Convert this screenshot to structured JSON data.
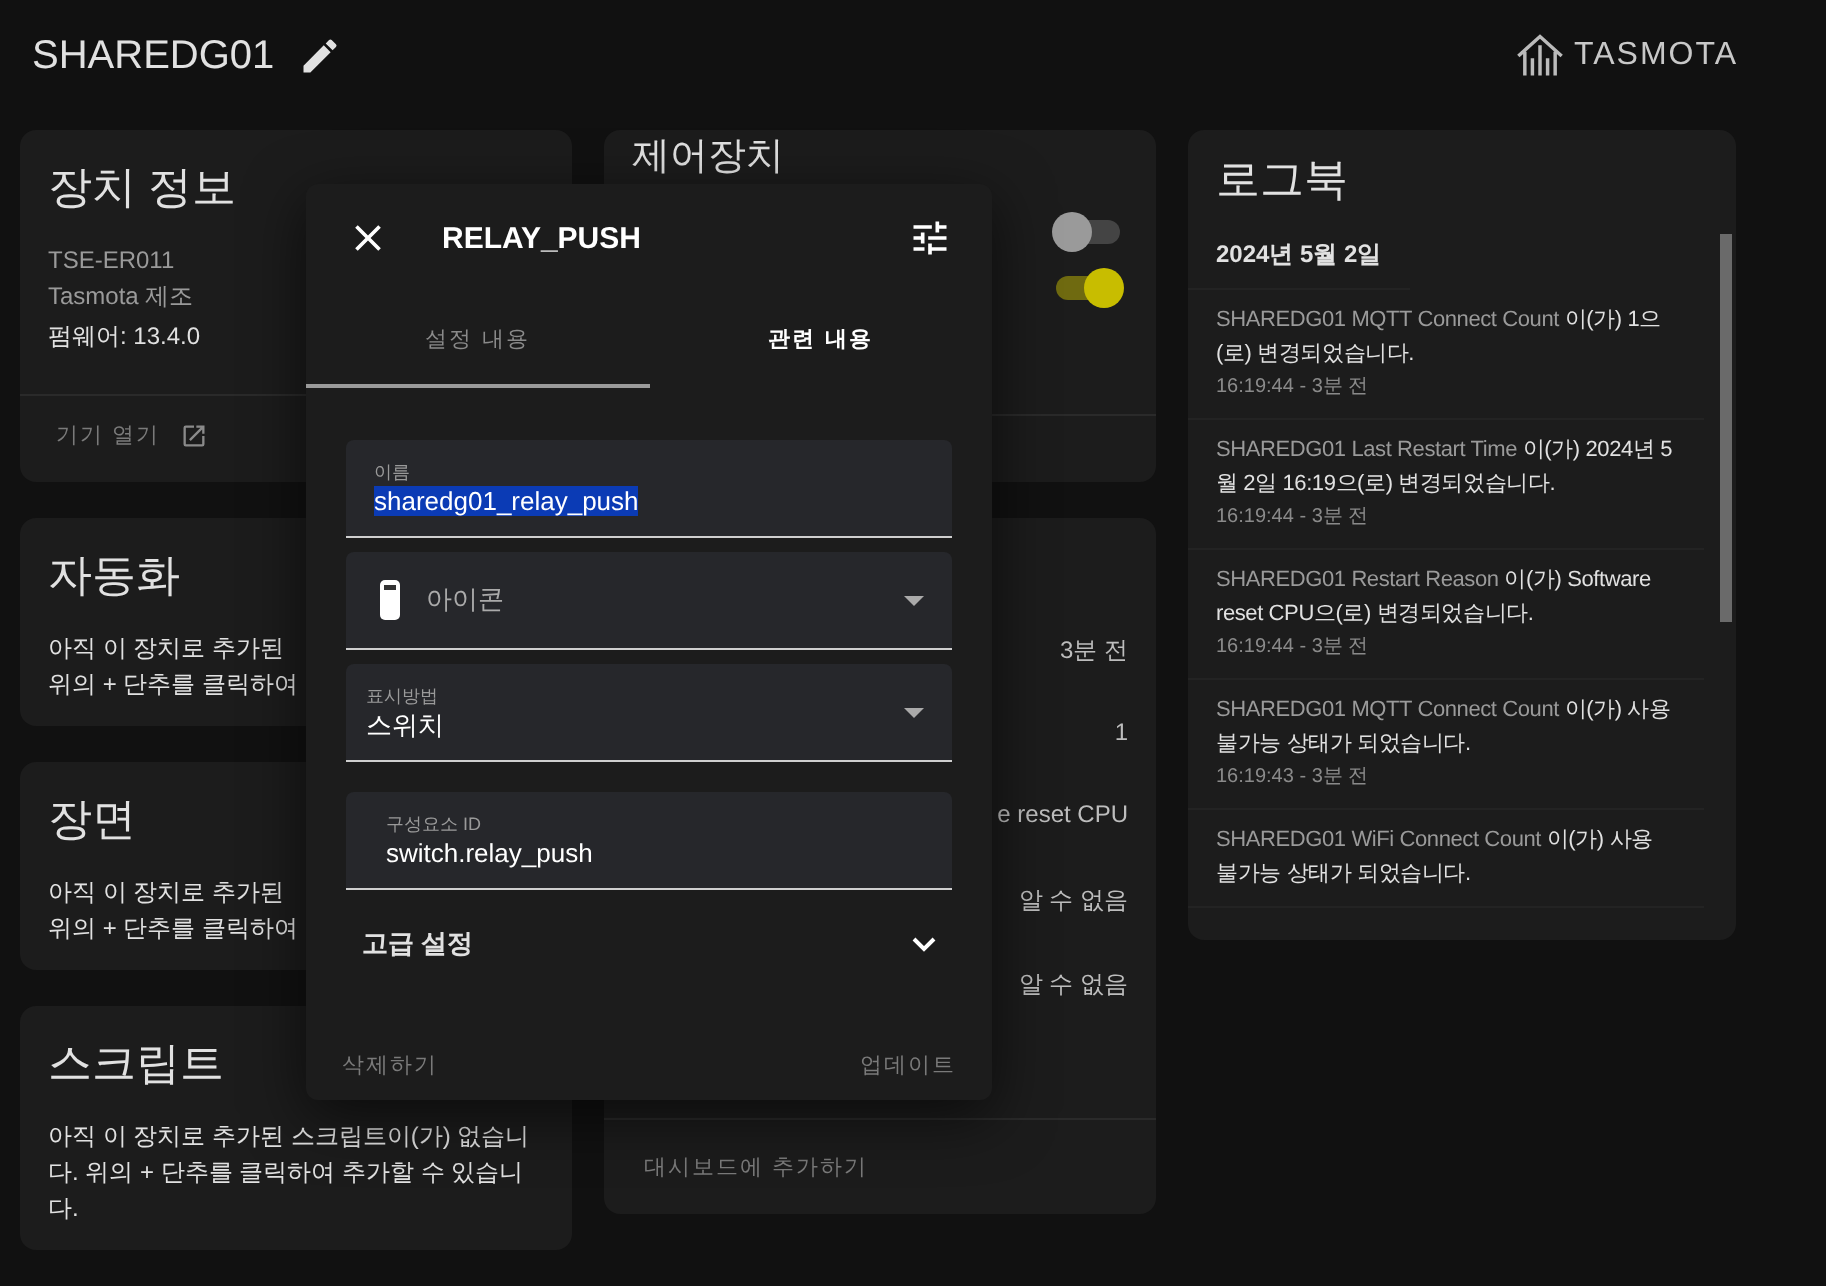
{
  "header": {
    "title": "SHAREDG01",
    "logo_text": "TASMOTA"
  },
  "device_card": {
    "title": "장치 정보",
    "model": "TSE-ER011",
    "maker": "Tasmota 제조",
    "firmware": "펌웨어: 13.4.0",
    "link": "기기 열기"
  },
  "info_cards": [
    {
      "title": "자동화",
      "lines": [
        "아직 이 장치로 추가된",
        "위의 + 단추를 클릭하여"
      ]
    },
    {
      "title": "장면",
      "lines": [
        "아직 이 장치로 추가된",
        "위의 + 단추를 클릭하여"
      ]
    },
    {
      "title": "스크립트",
      "lines": [
        "아직 이 장치로 추가된 스크립트이(가) 없습니다. 위의 + 단추를 클릭하여 추가할 수 있습니다."
      ]
    }
  ],
  "controls_card": {
    "title": "제어장치",
    "toggles": [
      {
        "on": false
      },
      {
        "on": true
      }
    ]
  },
  "sensors_card": {
    "values": [
      "3분 전",
      "1",
      "e reset CPU",
      "알 수 없음",
      "알 수 없음"
    ],
    "footer": "대시보드에 추가하기"
  },
  "logbook": {
    "title": "로그북",
    "date": "2024년 5월 2일",
    "entries": [
      {
        "entity": "SHAREDG01 MQTT Connect Count",
        "message": " 이(가) 1으(로) 변경되었습니다.",
        "time": "16:19:44 - 3분 전"
      },
      {
        "entity": "SHAREDG01 Last Restart Time",
        "message": " 이(가) 2024년 5월 2일 16:19으(로) 변경되었습니다.",
        "time": "16:19:44 - 3분 전"
      },
      {
        "entity": "SHAREDG01 Restart Reason",
        "message": " 이(가) Software reset CPU으(로) 변경되었습니다.",
        "time": "16:19:44 - 3분 전"
      },
      {
        "entity": "SHAREDG01 MQTT Connect Count",
        "message": " 이(가) 사용 불가능 상태가 되었습니다.",
        "time": "16:19:43 - 3분 전"
      },
      {
        "entity": "SHAREDG01 WiFi Connect Count",
        "message": " 이(가) 사용 불가능 상태가 되었습니다."
      }
    ]
  },
  "dialog": {
    "title": "RELAY_PUSH",
    "tabs": [
      {
        "label": "설정 내용",
        "selected": true
      },
      {
        "label": "관련 내용",
        "selected": false
      }
    ],
    "fields": [
      {
        "kind": "text",
        "label": "이름",
        "value": "sharedg01_relay_push",
        "highlighted": true
      },
      {
        "kind": "icon-select",
        "placeholder": "아이콘"
      },
      {
        "kind": "select",
        "label": "표시방법",
        "value": "스위치"
      },
      {
        "kind": "text",
        "label": "구성요소 ID",
        "value": "switch.relay_push",
        "highlighted": false
      }
    ],
    "advanced": "고급 설정",
    "delete": "삭제하기",
    "update": "업데이트"
  }
}
